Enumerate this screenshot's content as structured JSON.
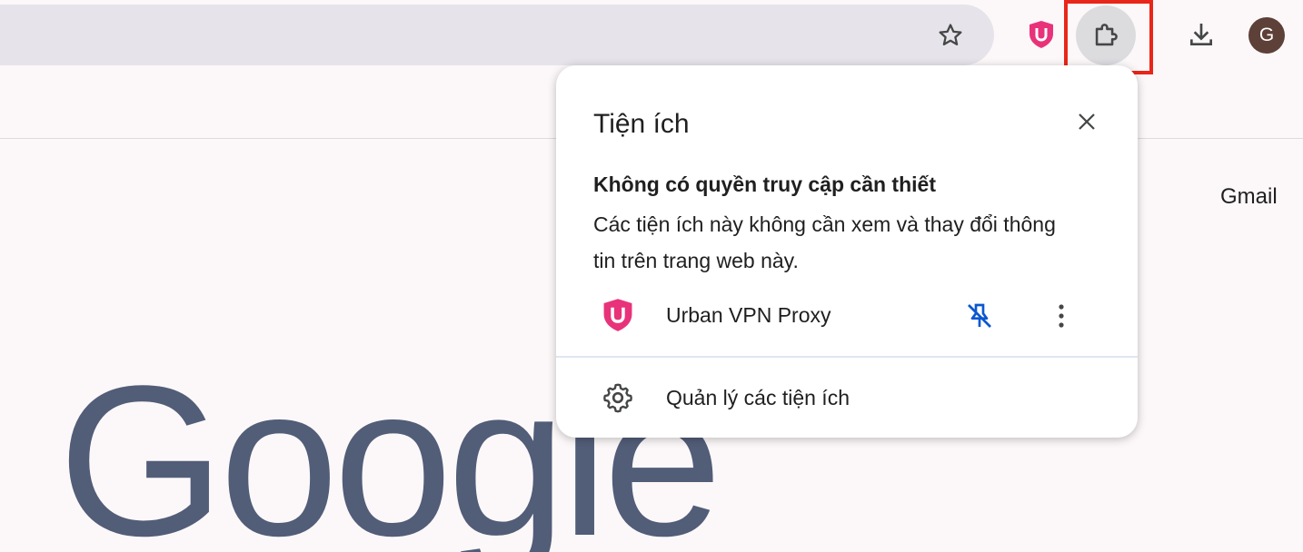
{
  "toolbar": {
    "bookmark_icon": "star-icon",
    "extension_icon": "urban-vpn-icon",
    "extensions_button_icon": "puzzle-icon",
    "download_icon": "download-icon",
    "avatar_letter": "G"
  },
  "page": {
    "gmail_link": "Gmail",
    "logo_text": "Google"
  },
  "popup": {
    "title": "Tiện ích",
    "close_icon": "close-icon",
    "section_heading": "Không có quyền truy cập cần thiết",
    "section_desc": "Các tiện ích này không cần xem và thay đổi thông tin trên trang web này.",
    "extensions": [
      {
        "name": "Urban VPN Proxy",
        "icon": "urban-vpn-icon",
        "pin_icon": "unpin-icon",
        "more_icon": "more-vert-icon"
      }
    ],
    "manage_label": "Quản lý các tiện ích",
    "manage_icon": "gear-icon"
  },
  "colors": {
    "highlight": "#e8261a",
    "pin_blue": "#0b57d0",
    "urban_pink": "#e8337a",
    "logo_gray": "#525d78"
  }
}
